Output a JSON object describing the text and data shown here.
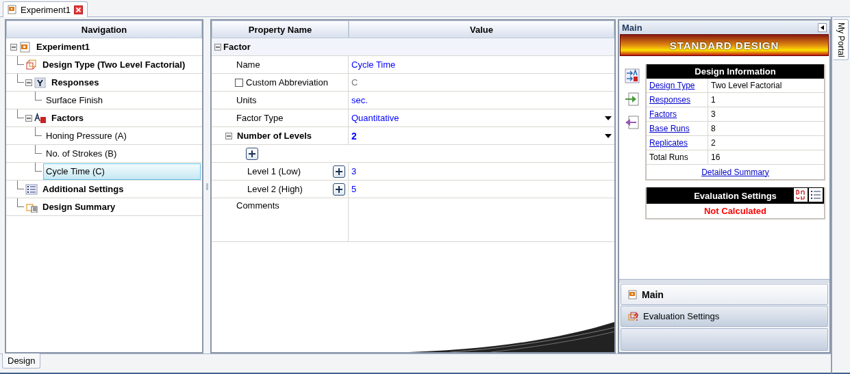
{
  "document_tabs": [
    {
      "label": "Experiment1",
      "selected": true
    }
  ],
  "navigation": {
    "title": "Navigation",
    "tree": [
      {
        "label": "Experiment1",
        "kind": "experiment",
        "selected": false,
        "expanded": true,
        "children": [
          {
            "label": "Design Type (Two Level Factorial)",
            "kind": "design_type",
            "selected": false
          },
          {
            "label": "Responses",
            "kind": "responses",
            "selected": false,
            "expanded": true,
            "children": [
              {
                "label": "Surface Finish",
                "kind": "leaf",
                "selected": false
              }
            ]
          },
          {
            "label": "Factors",
            "kind": "factors",
            "selected": false,
            "expanded": true,
            "children": [
              {
                "label": "Honing Pressure (A)",
                "kind": "leaf",
                "selected": false
              },
              {
                "label": "No. of Strokes (B)",
                "kind": "leaf",
                "selected": false
              },
              {
                "label": "Cycle Time (C)",
                "kind": "leaf",
                "selected": true
              }
            ]
          },
          {
            "label": "Additional Settings",
            "kind": "settings",
            "selected": false
          },
          {
            "label": "Design Summary",
            "kind": "summary",
            "selected": false
          }
        ]
      }
    ]
  },
  "property_grid": {
    "columns": [
      "Property Name",
      "Value"
    ],
    "category": {
      "label": "Factor",
      "expanded": true
    },
    "rows": [
      {
        "kind": "text",
        "name": "Name",
        "value": "Cycle Time"
      },
      {
        "kind": "checkbox",
        "name": "Custom Abbreviation",
        "checked": false,
        "value": "C"
      },
      {
        "kind": "text",
        "name": "Units",
        "value": "sec."
      },
      {
        "kind": "dropdown",
        "name": "Factor Type",
        "value": "Quantitative"
      },
      {
        "kind": "group",
        "name": "Number of Levels",
        "value": "2",
        "expanded": true
      },
      {
        "kind": "add"
      },
      {
        "kind": "level",
        "name": "Level 1 (Low)",
        "value": "3"
      },
      {
        "kind": "level",
        "name": "Level 2 (High)",
        "value": "5"
      },
      {
        "kind": "comments",
        "name": "Comments"
      }
    ]
  },
  "side_panel": {
    "title": "Main",
    "banner": "STANDARD DESIGN",
    "design_information": {
      "title": "Design Information",
      "rows": [
        {
          "label": "Design Type",
          "value": "Two Level Factorial",
          "link": true
        },
        {
          "label": "Responses",
          "value": "1",
          "link": true
        },
        {
          "label": "Factors",
          "value": "3",
          "link": true
        },
        {
          "label": "Base Runs",
          "value": "8",
          "link": true
        },
        {
          "label": "Replicates",
          "value": "2",
          "link": true
        },
        {
          "label": "Total Runs",
          "value": "16",
          "link": false
        }
      ],
      "footer_link": "Detailed Summary"
    },
    "evaluation": {
      "title": "Evaluation Settings",
      "status": "Not Calculated"
    },
    "sections": [
      {
        "label": "Main",
        "selected": true
      },
      {
        "label": "Evaluation Settings",
        "selected": false
      }
    ]
  },
  "bottom_tabs": [
    {
      "label": "Design",
      "selected": true
    }
  ],
  "side_tab": "My Portal"
}
